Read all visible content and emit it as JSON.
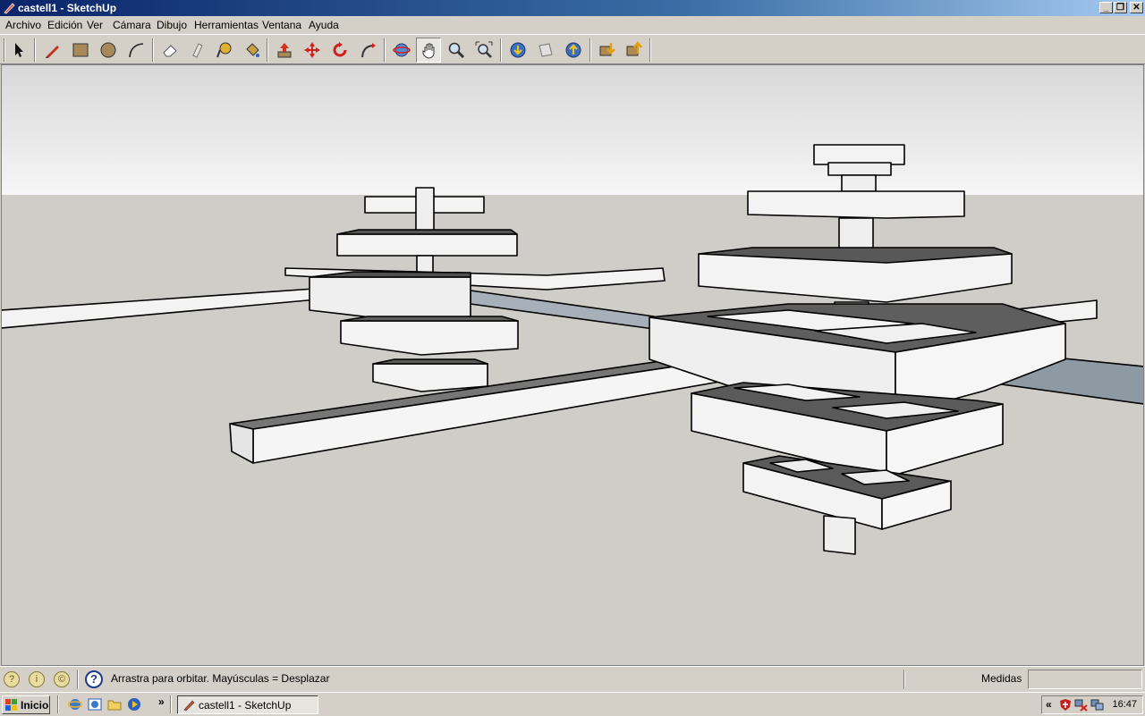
{
  "window": {
    "title": "castell1 - SketchUp"
  },
  "menu": {
    "items": [
      "Archivo",
      "Edición",
      "Ver",
      "Cámara",
      "Dibujo",
      "Herramientas",
      "Ventana",
      "Ayuda"
    ]
  },
  "toolbar": {
    "tools": [
      "select-icon",
      "pencil-icon",
      "rectangle-icon",
      "circle-icon",
      "arc-icon",
      "eraser-icon",
      "paint-eraser-icon",
      "tape-measure-icon",
      "paint-bucket-icon",
      "push-pull-icon",
      "move-icon",
      "rotate-icon",
      "follow-me-icon",
      "orbit-icon",
      "pan-icon",
      "zoom-icon",
      "zoom-extents-icon",
      "get-models-icon",
      "share-model-icon",
      "upload-icon",
      "get-components-icon",
      "share-components-icon"
    ],
    "active_tool": "pan-icon"
  },
  "statusbar": {
    "message": "Arrastra para orbitar.  Mayúsculas = Desplazar",
    "measurements_label": "Medidas",
    "measurements_value": ""
  },
  "taskbar": {
    "start_label": "Inicio",
    "task_label": "castell1 - SketchUp",
    "overflow": "»",
    "tray_collapse": "«",
    "clock": "16:47"
  },
  "colors": {
    "sky": "#f2f2f2",
    "ground": "#cfcdc8",
    "face": "#f0f0f0",
    "edge": "#000000"
  }
}
